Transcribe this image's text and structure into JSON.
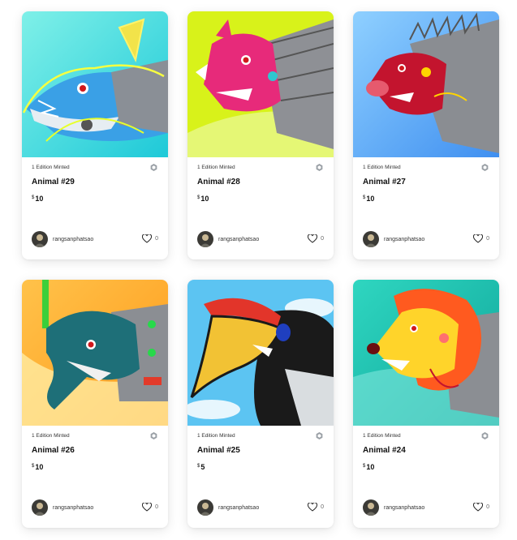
{
  "cards": [
    {
      "edition": "1 Edition Minted",
      "name": "Animal #29",
      "currency": "$",
      "price": "10",
      "creator": "rangsanphatsao",
      "likes": "0",
      "art": "shark"
    },
    {
      "edition": "1 Edition Minted",
      "name": "Animal #28",
      "currency": "$",
      "price": "10",
      "creator": "rangsanphatsao",
      "likes": "0",
      "art": "rhino"
    },
    {
      "edition": "1 Edition Minted",
      "name": "Animal #27",
      "currency": "$",
      "price": "10",
      "creator": "rangsanphatsao",
      "likes": "0",
      "art": "boar"
    },
    {
      "edition": "1 Edition Minted",
      "name": "Animal #26",
      "currency": "$",
      "price": "10",
      "creator": "rangsanphatsao",
      "likes": "0",
      "art": "elephant"
    },
    {
      "edition": "1 Edition Minted",
      "name": "Animal #25",
      "currency": "$",
      "price": "5",
      "creator": "rangsanphatsao",
      "likes": "0",
      "art": "hornbill"
    },
    {
      "edition": "1 Edition Minted",
      "name": "Animal #24",
      "currency": "$",
      "price": "10",
      "creator": "rangsanphatsao",
      "likes": "0",
      "art": "lion"
    }
  ],
  "icons": {
    "chain": "chain-hex-icon",
    "like": "heart-outline-icon",
    "avatar": "creator-avatar"
  }
}
